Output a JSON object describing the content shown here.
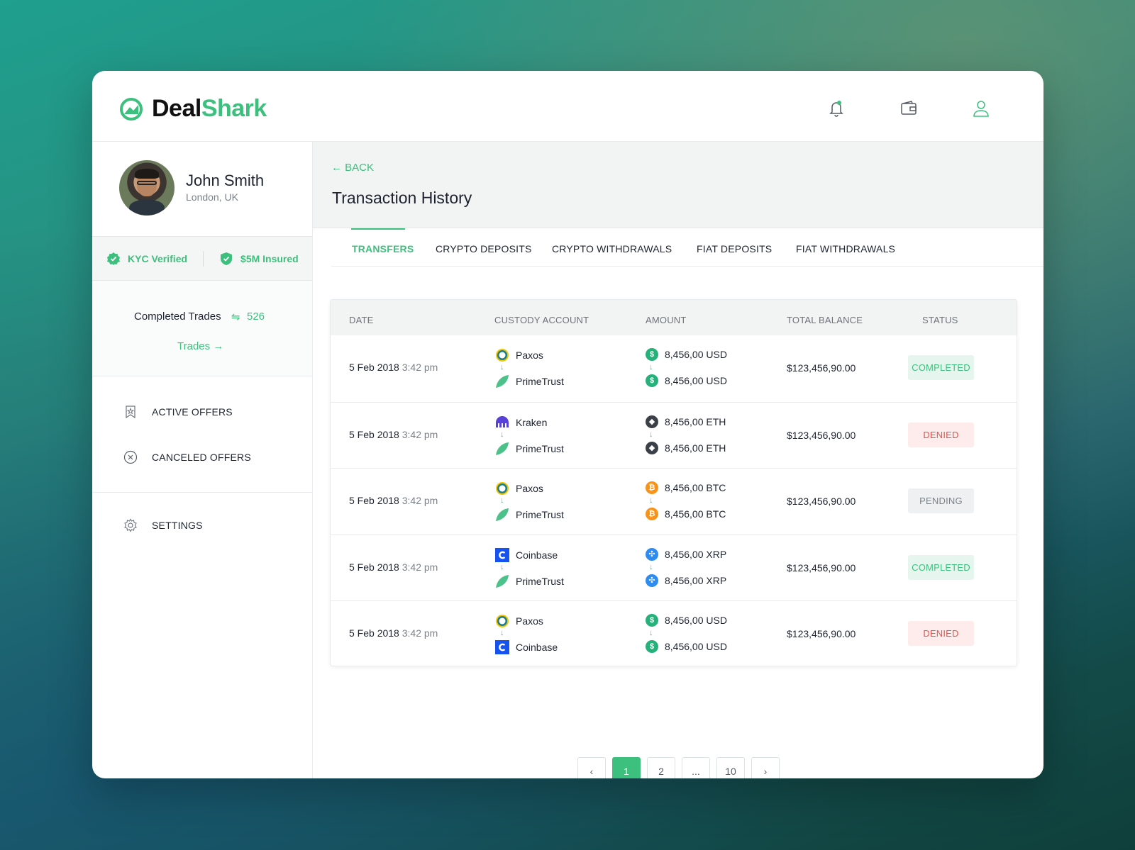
{
  "app": {
    "brand_part1": "Deal",
    "brand_part2": "Shark",
    "accent_color": "#3dbf7d"
  },
  "header": {
    "icons": [
      "bell-icon",
      "wallet-icon",
      "user-icon"
    ]
  },
  "profile": {
    "name": "John Smith",
    "location": "London, UK"
  },
  "badges": {
    "kyc": "KYC Verified",
    "insured": "$5M Insured"
  },
  "stats": {
    "completed_trades_label": "Completed Trades",
    "completed_trades_value": "526",
    "trades_link": "Trades"
  },
  "sidebar": {
    "items": [
      {
        "label": "ACTIVE OFFERS",
        "icon": "bookmark-star-icon"
      },
      {
        "label": "CANCELED OFFERS",
        "icon": "circle-x-icon"
      },
      {
        "label": "SETTINGS",
        "icon": "gear-icon"
      }
    ]
  },
  "page": {
    "back_label": "BACK",
    "title": "Transaction History"
  },
  "tabs": [
    {
      "label": "TRANSFERS",
      "active": true
    },
    {
      "label": "CRYPTO DEPOSITS",
      "active": false
    },
    {
      "label": "CRYPTO WITHDRAWALS",
      "active": false
    },
    {
      "label": "FIAT DEPOSITS",
      "active": false
    },
    {
      "label": "FIAT WITHDRAWALS",
      "active": false
    }
  ],
  "table": {
    "columns": [
      "DATE",
      "CUSTODY ACCOUNT",
      "AMOUNT",
      "TOTAL BALANCE",
      "STATUS"
    ],
    "rows": [
      {
        "date": "5 Feb 2018",
        "time": "3:42 pm",
        "from": "Paxos",
        "to": "PrimeTrust",
        "amount_from": "8,456,00 USD",
        "amount_to": "8,456,00 USD",
        "coin": "USD",
        "total": "$123,456,90.00",
        "status": "COMPLETED"
      },
      {
        "date": "5 Feb 2018",
        "time": "3:42 pm",
        "from": "Kraken",
        "to": "PrimeTrust",
        "amount_from": "8,456,00 ETH",
        "amount_to": "8,456,00 ETH",
        "coin": "ETH",
        "total": "$123,456,90.00",
        "status": "DENIED"
      },
      {
        "date": "5 Feb 2018",
        "time": "3:42 pm",
        "from": "Paxos",
        "to": "PrimeTrust",
        "amount_from": "8,456,00 BTC",
        "amount_to": "8,456,00 BTC",
        "coin": "BTC",
        "total": "$123,456,90.00",
        "status": "PENDING"
      },
      {
        "date": "5 Feb 2018",
        "time": "3:42 pm",
        "from": "Coinbase",
        "to": "PrimeTrust",
        "amount_from": "8,456,00 XRP",
        "amount_to": "8,456,00 XRP",
        "coin": "XRP",
        "total": "$123,456,90.00",
        "status": "COMPLETED"
      },
      {
        "date": "5 Feb 2018",
        "time": "3:42 pm",
        "from": "Paxos",
        "to": "Coinbase",
        "amount_from": "8,456,00 USD",
        "amount_to": "8,456,00 USD",
        "coin": "USD",
        "total": "$123,456,90.00",
        "status": "DENIED"
      }
    ]
  },
  "pagination": {
    "pages": [
      "1",
      "2",
      "...",
      "10"
    ],
    "current": "1"
  }
}
